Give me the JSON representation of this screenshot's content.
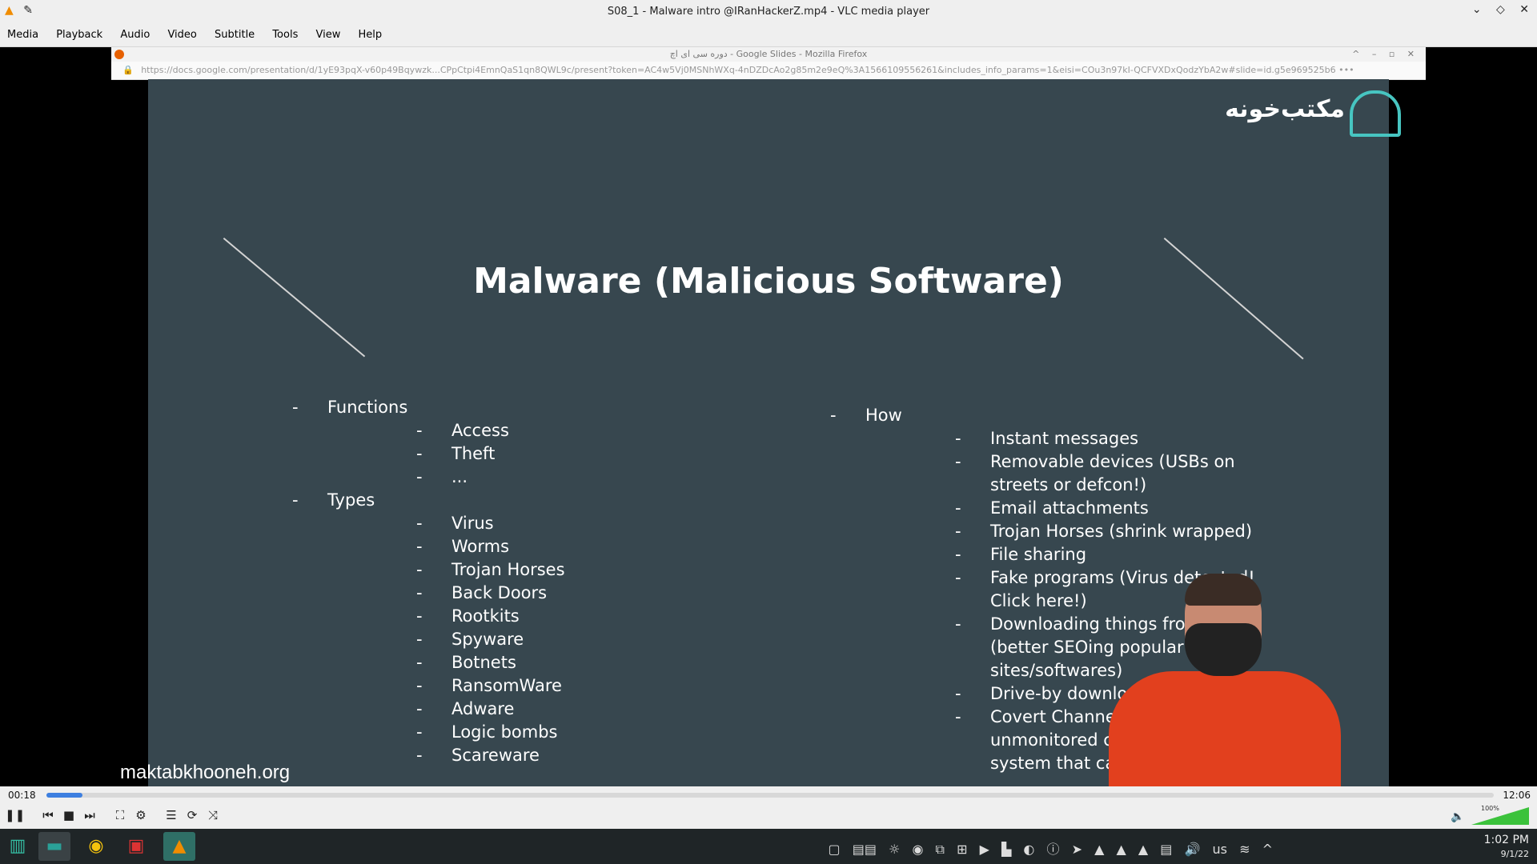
{
  "window": {
    "title": "S08_1 - Malware intro @IRanHackerZ.mp4 - VLC media player"
  },
  "menu": [
    "Media",
    "Playback",
    "Audio",
    "Video",
    "Subtitle",
    "Tools",
    "View",
    "Help"
  ],
  "browser": {
    "title": "دوره سی ای اچ - Google Slides - Mozilla Firefox",
    "url": "https://docs.google.com/presentation/d/1yE93pqX-v60p49Bqywzk...CPpCtpi4EmnQaS1qn8QWL9c/present?token=AC4w5Vj0MSNhWXq-4nDZDcAo2g85m2e9eQ%3A1566109556261&includes_info_params=1&eisi=COu3n97kI-QCFVXDxQodzYbA2w#slide=id.g5e969525b6 •••"
  },
  "slide": {
    "logo_text": "مکتب‌خونه",
    "title": "Malware (Malicious Software)",
    "left": [
      {
        "level": 1,
        "text": "Functions"
      },
      {
        "level": 2,
        "text": "Access"
      },
      {
        "level": 2,
        "text": "Theft"
      },
      {
        "level": 2,
        "text": "..."
      },
      {
        "level": 1,
        "text": "Types"
      },
      {
        "level": 2,
        "text": "Virus"
      },
      {
        "level": 2,
        "text": "Worms"
      },
      {
        "level": 2,
        "text": "Trojan Horses"
      },
      {
        "level": 2,
        "text": "Back Doors"
      },
      {
        "level": 2,
        "text": "Rootkits"
      },
      {
        "level": 2,
        "text": "Spyware"
      },
      {
        "level": 2,
        "text": "Botnets"
      },
      {
        "level": 2,
        "text": "RansomWare"
      },
      {
        "level": 2,
        "text": "Adware"
      },
      {
        "level": 2,
        "text": "Logic bombs"
      },
      {
        "level": 2,
        "text": "Scareware"
      }
    ],
    "right_heading": "How",
    "right": [
      {
        "dash": true,
        "text": "Instant messages"
      },
      {
        "dash": true,
        "text": "Removable devices (USBs on"
      },
      {
        "dash": false,
        "text": "streets or defcon!)"
      },
      {
        "dash": true,
        "text": "Email attachments"
      },
      {
        "dash": true,
        "text": "Trojan Horses (shrink wrapped)"
      },
      {
        "dash": true,
        "text": "File sharing"
      },
      {
        "dash": true,
        "text": "Fake programs (Virus detected!"
      },
      {
        "dash": false,
        "text": "Click here!)"
      },
      {
        "dash": true,
        "text": "Downloading things from  rnet"
      },
      {
        "dash": false,
        "text": "(better SEOing popular"
      },
      {
        "dash": false,
        "text": "sites/softwares)"
      },
      {
        "dash": true,
        "text": "Drive-by download (auto s)"
      },
      {
        "dash": true,
        "text": "Covert Channels (unknow"
      },
      {
        "dash": false,
        "text": "unmonitored compone"
      },
      {
        "dash": false,
        "text": "system that can b"
      }
    ],
    "watermark": "maktabkhooneh.org"
  },
  "player": {
    "elapsed": "00:18",
    "total": "12:06",
    "progress": 0.025,
    "volume_label": "100%",
    "volume": 1.0
  },
  "taskbar": {
    "keyboard": "us",
    "time": "1:02 PM",
    "date": "9/1/22"
  },
  "colors": {
    "slide_bg": "#37474f",
    "accent": "#3d7fe0",
    "taskbar_bg": "#1f2527"
  }
}
